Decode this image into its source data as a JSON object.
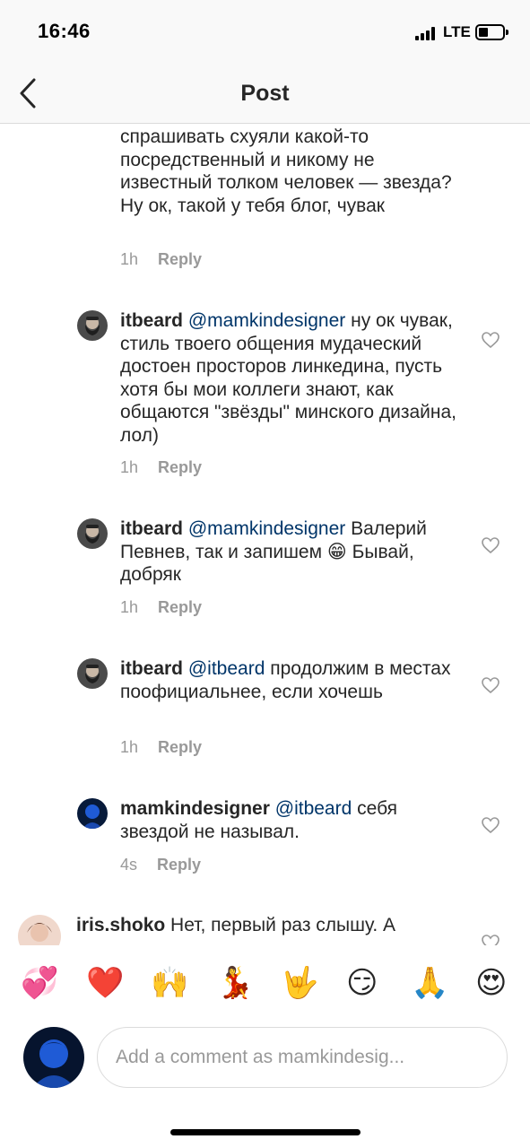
{
  "status_bar": {
    "time": "16:46",
    "network": "LTE"
  },
  "nav": {
    "title": "Post"
  },
  "comments": [
    {
      "text": "спрашивать схуяли какой-то посредственный и никому не известный толком человек — звезда? Ну ок, такой у тебя блог, чувак",
      "time": "1h",
      "reply_label": "Reply"
    },
    {
      "user": "itbeard",
      "mention": "@mamkindesigner",
      "text": "ну ок чувак, стиль твоего общения мудаческий достоен просторов линкедина, пусть хотя бы мои коллеги знают, как общаются \"звёзды\" минского дизайна, лол)",
      "time": "1h",
      "reply_label": "Reply"
    },
    {
      "user": "itbeard",
      "mention": "@mamkindesigner",
      "text": "Валерий Певнев, так и запишем 😁 Бывай, добряк",
      "time": "1h",
      "reply_label": "Reply"
    },
    {
      "user": "itbeard",
      "mention": "@itbeard",
      "text": "продолжим в местах поофициальнее, если хочешь",
      "time": "1h",
      "reply_label": "Reply"
    },
    {
      "user": "mamkindesigner",
      "mention": "@itbeard",
      "text": "себя звездой не называл.",
      "time": "4s",
      "reply_label": "Reply"
    },
    {
      "user": "iris.shoko",
      "text": "Нет, первый раз слышу. А"
    }
  ],
  "emoji_bar": [
    "💞",
    "❤️",
    "🙌",
    "💃",
    "🤟",
    "😏",
    "🙏",
    "😍"
  ],
  "compose": {
    "placeholder": "Add a comment as mamkindesig..."
  },
  "colors": {
    "mention": "#003569",
    "meta": "#999999",
    "bar_bg": "#f9f9f9",
    "accent_avatar": "#1f5bd6"
  }
}
